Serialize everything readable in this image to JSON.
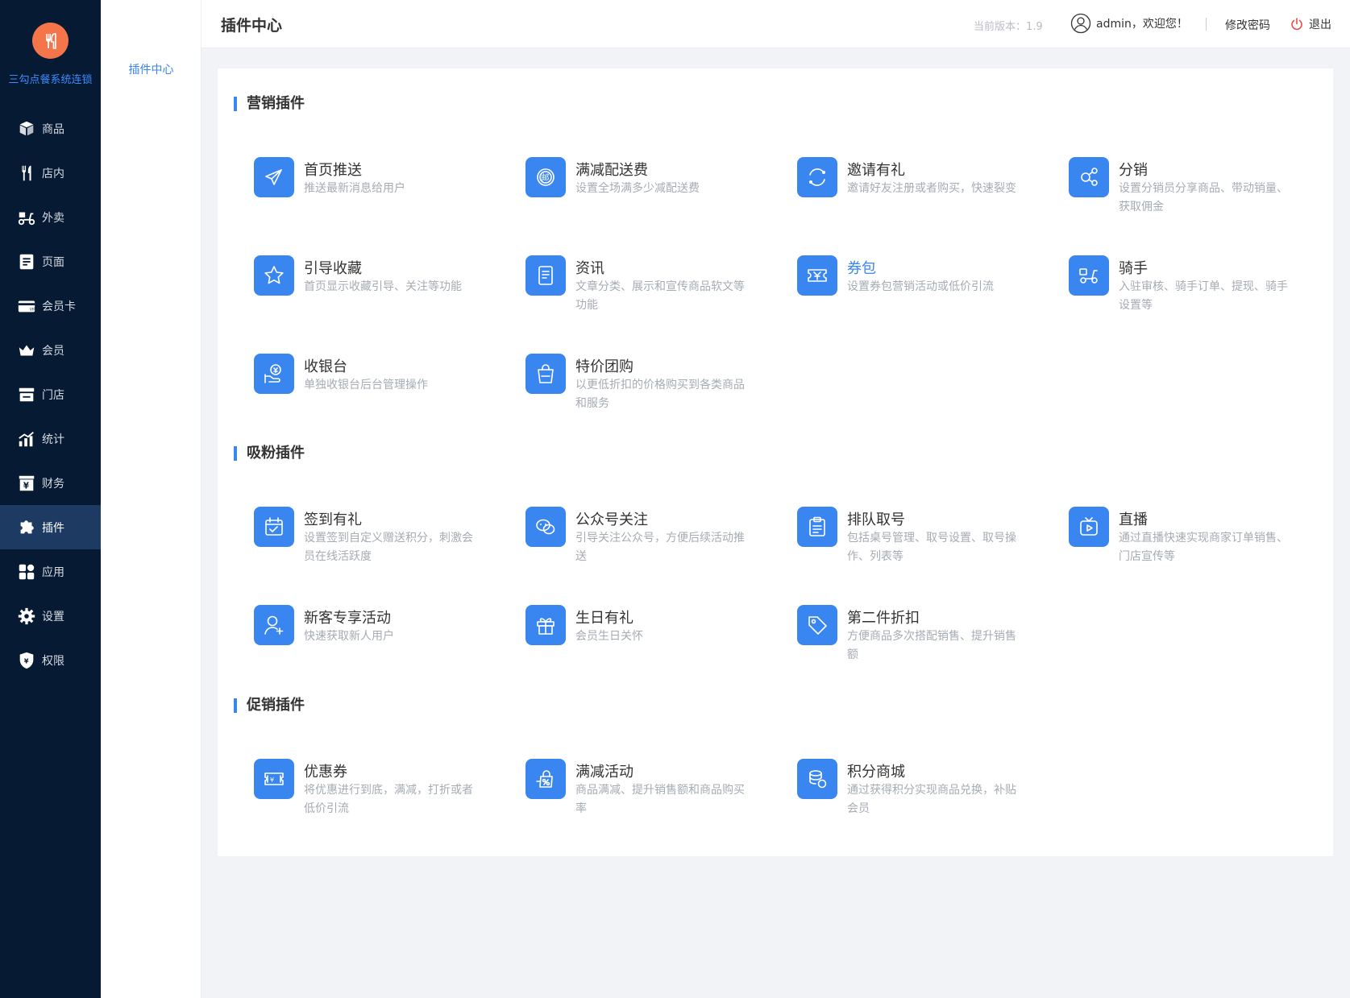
{
  "brand": "三勾点餐系统连锁",
  "nav": [
    {
      "label": "商品",
      "icon": "box-icon"
    },
    {
      "label": "店内",
      "icon": "fork-knife-icon"
    },
    {
      "label": "外卖",
      "icon": "scooter-icon"
    },
    {
      "label": "页面",
      "icon": "page-icon"
    },
    {
      "label": "会员卡",
      "icon": "vip-card-icon"
    },
    {
      "label": "会员",
      "icon": "crown-icon"
    },
    {
      "label": "门店",
      "icon": "store-icon"
    },
    {
      "label": "统计",
      "icon": "chart-icon"
    },
    {
      "label": "财务",
      "icon": "finance-icon"
    },
    {
      "label": "插件",
      "icon": "puzzle-icon",
      "active": true
    },
    {
      "label": "应用",
      "icon": "apps-icon"
    },
    {
      "label": "设置",
      "icon": "gear-icon"
    },
    {
      "label": "权限",
      "icon": "shield-icon"
    }
  ],
  "subnav": {
    "item": "插件中心"
  },
  "header": {
    "title": "插件中心",
    "version": "当前版本：1.9",
    "user": "admin，欢迎您！",
    "change_password": "修改密码",
    "logout": "退出"
  },
  "sections": [
    {
      "title": "营销插件",
      "plugins": [
        {
          "name": "首页推送",
          "desc": "推送最新消息给用户",
          "icon": "send-icon"
        },
        {
          "name": "满减配送费",
          "desc": "设置全场满多少减配送费",
          "icon": "mail-badge-icon"
        },
        {
          "name": "邀请有礼",
          "desc": "邀请好友注册或者购买，快速裂变",
          "icon": "refresh-icon"
        },
        {
          "name": "分销",
          "desc": "设置分销员分享商品、带动销量、获取佣金",
          "icon": "share-icon"
        },
        {
          "name": "引导收藏",
          "desc": "首页显示收藏引导、关注等功能",
          "icon": "star-icon"
        },
        {
          "name": "资讯",
          "desc": "文章分类、展示和宣传商品软文等功能",
          "icon": "document-icon"
        },
        {
          "name": "券包",
          "desc": "设置券包营销活动或低价引流",
          "icon": "ticket-icon",
          "highlight": true
        },
        {
          "name": "骑手",
          "desc": "入驻审核、骑手订单、提现、骑手设置等",
          "icon": "scooter-icon"
        },
        {
          "name": "收银台",
          "desc": "单独收银台后台管理操作",
          "icon": "cashier-icon"
        },
        {
          "name": "特价团购",
          "desc": "以更低折扣的价格购买到各类商品和服务",
          "icon": "shopping-bag-icon"
        }
      ]
    },
    {
      "title": "吸粉插件",
      "plugins": [
        {
          "name": "签到有礼",
          "desc": "设置签到自定义赠送积分，刺激会员在线活跃度",
          "icon": "calendar-check-icon"
        },
        {
          "name": "公众号关注",
          "desc": "引导关注公众号，方便后续活动推送",
          "icon": "wechat-icon"
        },
        {
          "name": "排队取号",
          "desc": "包括桌号管理、取号设置、取号操作、列表等",
          "icon": "clipboard-icon"
        },
        {
          "name": "直播",
          "desc": "通过直播快速实现商家订单销售、门店宣传等",
          "icon": "tv-play-icon"
        },
        {
          "name": "新客专享活动",
          "desc": "快速获取新人用户",
          "icon": "user-plus-icon"
        },
        {
          "name": "生日有礼",
          "desc": "会员生日关怀",
          "icon": "gift-icon"
        },
        {
          "name": "第二件折扣",
          "desc": "方便商品多次搭配销售、提升销售额",
          "icon": "tag-icon"
        }
      ]
    },
    {
      "title": "促销插件",
      "plugins": [
        {
          "name": "优惠券",
          "desc": "将优惠进行到底，满减，打折或者低价引流",
          "icon": "coupon-icon"
        },
        {
          "name": "满减活动",
          "desc": "商品满减、提升销售额和商品购买率",
          "icon": "discount-icon"
        },
        {
          "name": "积分商城",
          "desc": "通过获得积分实现商品兑换，补贴会员",
          "icon": "coins-icon"
        }
      ]
    }
  ]
}
